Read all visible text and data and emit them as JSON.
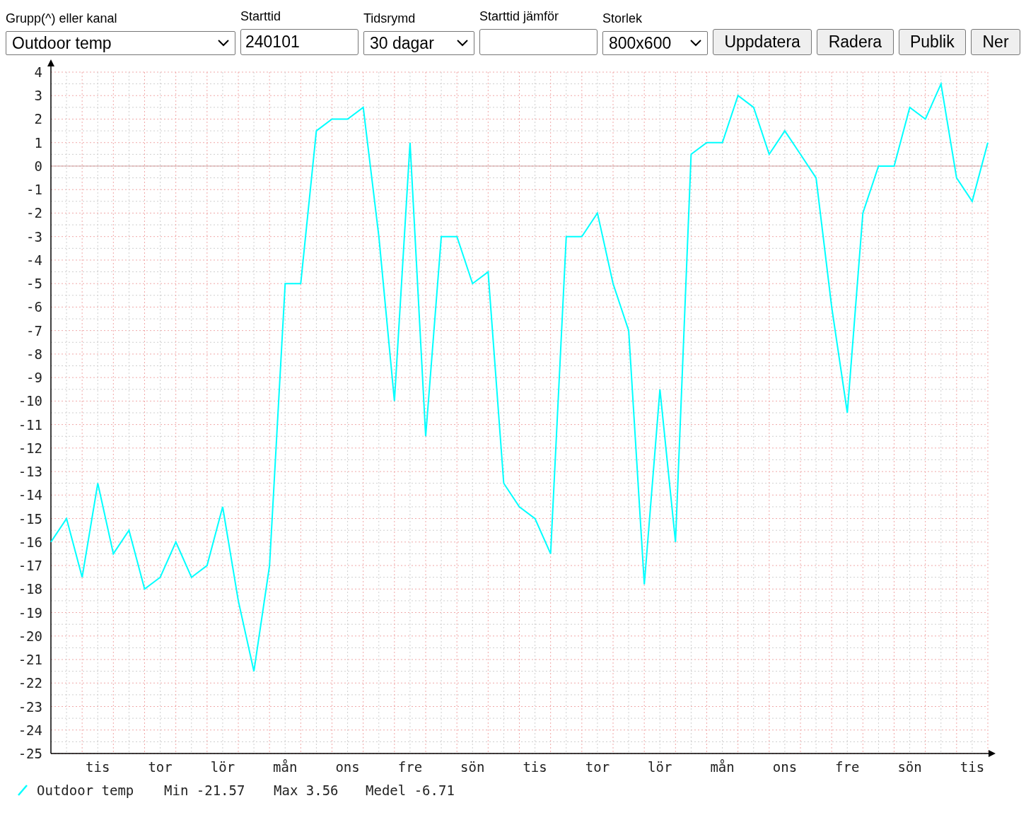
{
  "toolbar": {
    "fields": [
      {
        "kind": "select",
        "label": "Grupp(^) eller kanal",
        "value": "Outdoor temp"
      },
      {
        "kind": "text",
        "label": "Starttid",
        "value": "240101"
      },
      {
        "kind": "select",
        "label": "Tidsrymd",
        "value": "30 dagar"
      },
      {
        "kind": "text",
        "label": "Starttid jämför"
      },
      {
        "kind": "select",
        "label": "Storlek",
        "value": "800x600"
      }
    ],
    "buttons": [
      "Uppdatera",
      "Radera",
      "Publik",
      "Ner"
    ]
  },
  "chart": {
    "chart_data": {
      "type": "line",
      "categories": [
        null,
        null,
        null,
        "tis",
        null,
        null,
        null,
        "tor",
        null,
        null,
        null,
        "lör",
        null,
        null,
        null,
        "mån",
        null,
        null,
        null,
        "ons",
        null,
        null,
        null,
        "fre",
        null,
        null,
        null,
        "sön",
        null,
        null,
        null,
        "tis",
        null,
        null,
        null,
        "tor",
        null,
        null,
        null,
        "lör",
        null,
        null,
        null,
        "mån",
        null,
        null,
        null,
        "ons",
        null,
        null,
        null,
        "fre",
        null,
        null,
        null,
        "sön",
        null,
        null,
        null,
        "tis",
        null
      ],
      "series": [
        {
          "name": "Outdoor temp",
          "color": "#00ffff",
          "values": [
            -16,
            -15,
            -17.5,
            -13.5,
            -16.5,
            -15.5,
            -18,
            -17.5,
            -16,
            -17.5,
            -17,
            -14.5,
            -18.5,
            -21.5,
            -17,
            -5,
            -5,
            1.5,
            2,
            2,
            2.5,
            -3,
            -10,
            1,
            -11.5,
            -3,
            -3,
            -5,
            -4.5,
            -13.5,
            -14.5,
            -15,
            -16.5,
            -3,
            -3,
            -2,
            -5,
            -7,
            -17.8,
            -9.5,
            -16,
            0.5,
            1,
            1,
            3,
            2.5,
            0.5,
            1.5,
            0.5,
            -0.5,
            -6,
            -10.5,
            -2,
            0,
            0,
            2.5,
            2,
            3.5,
            -0.5,
            -1.5,
            1
          ]
        }
      ],
      "ylim": [
        -25,
        4
      ],
      "grid": true,
      "yticks": [
        -25,
        -24,
        -23,
        -22,
        -21,
        -20,
        -19,
        -18,
        -17,
        -16,
        -15,
        -14,
        -13,
        -12,
        -11,
        -10,
        -9,
        -8,
        -7,
        -6,
        -5,
        -4,
        -3,
        -2,
        -1,
        0,
        1,
        2,
        3,
        4
      ]
    },
    "legend": {
      "stats": [
        "Min -21.57",
        "Max 3.56",
        "Medel -6.71"
      ]
    }
  }
}
